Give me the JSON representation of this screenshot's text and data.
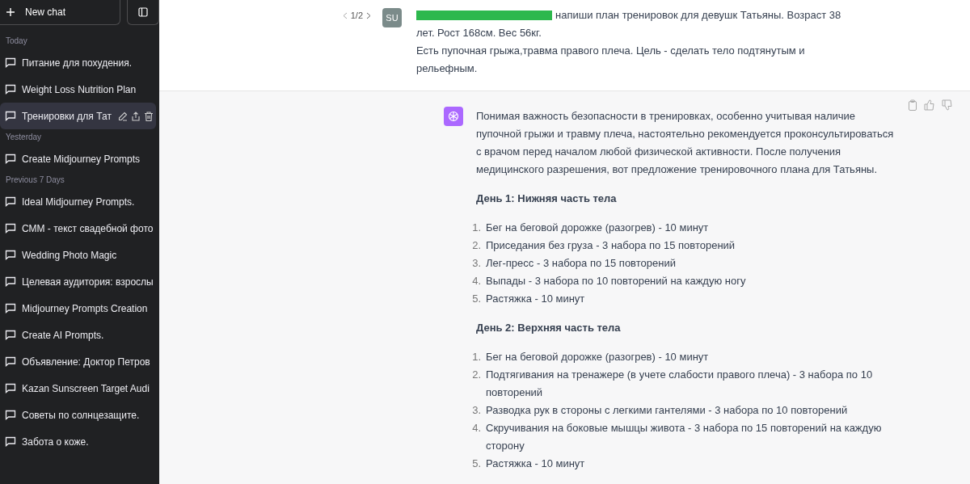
{
  "sidebar": {
    "new_chat": "New chat",
    "groups": [
      {
        "label": "Today",
        "items": [
          {
            "title": "Питание для похудения.",
            "selected": false
          },
          {
            "title": "Weight Loss Nutrition Plan",
            "selected": false
          },
          {
            "title": "Тренировки для Тат",
            "selected": true
          }
        ]
      },
      {
        "label": "Yesterday",
        "items": [
          {
            "title": "Create Midjourney Prompts",
            "selected": false
          }
        ]
      },
      {
        "label": "Previous 7 Days",
        "items": [
          {
            "title": "Ideal Midjourney Prompts.",
            "selected": false
          },
          {
            "title": "СММ - текст свадебной фото",
            "selected": false
          },
          {
            "title": "Wedding Photo Magic",
            "selected": false
          },
          {
            "title": "Целевая аудитория: взрослы",
            "selected": false
          },
          {
            "title": "Midjourney Prompts Creation",
            "selected": false
          },
          {
            "title": "Create AI Prompts.",
            "selected": false
          },
          {
            "title": "Объявление: Доктор Петров",
            "selected": false
          },
          {
            "title": "Kazan Sunscreen Target Audi",
            "selected": false
          },
          {
            "title": "Советы по солнцезащите.",
            "selected": false
          },
          {
            "title": "Забота о коже.",
            "selected": false
          }
        ]
      }
    ]
  },
  "user_message": {
    "pager": "1/2",
    "avatar": "SU",
    "paragraphs": [
      "напиши план тренировок для девушк Татьяны. Возраст 38",
      "лет. Рост 168см. Вес 56кг.",
      "Есть пупочная грыжа,травма правого плеча. Цель - сделать тело подтянутым и рельефным."
    ]
  },
  "assistant_message": {
    "blocks": [
      {
        "kind": "paragraph",
        "text": "Понимая важность безопасности в тренировках, особенно учитывая наличие пупочной грыжи и травму плеча, настоятельно рекомендуется проконсультироваться с врачом перед началом любой физической активности. После получения медицинского разрешения, вот предложение тренировочного плана для Татьяны."
      },
      {
        "kind": "heading",
        "text": "День 1: Нижняя часть тела"
      },
      {
        "kind": "list",
        "items": [
          {
            "number": "1.",
            "text": "Бег на беговой дорожке (разогрев) - 10 минут"
          },
          {
            "number": "2.",
            "text": "Приседания без груза - 3 набора по 15 повторений"
          },
          {
            "number": "3.",
            "text": "Лег-пресс - 3 набора по 15 повторений"
          },
          {
            "number": "4.",
            "text": "Выпады - 3 набора по 10 повторений на каждую ногу"
          },
          {
            "number": "5.",
            "text": "Растяжка - 10 минут"
          }
        ]
      },
      {
        "kind": "heading",
        "text": "День 2: Верхняя часть тела"
      },
      {
        "kind": "list",
        "items": [
          {
            "number": "1.",
            "text": "Бег на беговой дорожке (разогрев) - 10 минут"
          },
          {
            "number": "2.",
            "text": "Подтягивания на тренажере (в учете слабости правого плеча) - 3 набора по 10 повторений"
          },
          {
            "number": "3.",
            "text": "Разводка рук в стороны с легкими гантелями - 3 набора по 10 повторений"
          },
          {
            "number": "4.",
            "text": "Скручивания на боковые мышцы живота - 3 набора по 15 повторений на каждую сторону"
          },
          {
            "number": "5.",
            "text": "Растяжка - 10 минут"
          }
        ]
      }
    ]
  }
}
